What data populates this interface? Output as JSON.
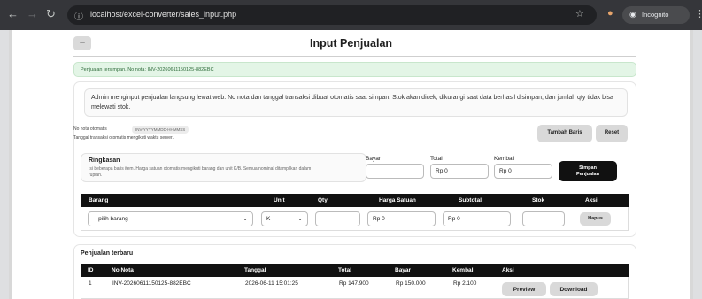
{
  "browser": {
    "url": "localhost/excel-converter/sales_input.php",
    "incognito_label": "Incognito"
  },
  "page": {
    "title": "Input Penjualan",
    "back_label": "←",
    "alert": "Penjualan tersimpan. No nota: INV-20260611150125-882EBC",
    "info": "Admin menginput penjualan langsung lewat web. No nota dan tanggal transaksi dibuat otomatis saat simpan. Stok akan dicek, dikurangi saat data berhasil disimpan, dan jumlah qty tidak bisa melewati stok.",
    "nota_label": "No nota otomatis",
    "nota_pattern": "INV-YYYYMMDD-HHMMSS",
    "date_note": "Tanggal transaksi otomatis mengikuti waktu server.",
    "add_row_label": "Tambah Baris",
    "reset_label": "Reset"
  },
  "summary": {
    "heading": "Ringkasan",
    "desc": "Isi beberapa baris item. Harga satuan otomatis mengikuti barang dan unit K/B. Semua nominal ditampilkan dalam rupiah.",
    "bayar_label": "Bayar",
    "bayar_value": "",
    "total_label": "Total",
    "total_value": "Rp 0",
    "kembali_label": "Kembali",
    "kembali_value": "Rp 0",
    "save_label_1": "Simpan",
    "save_label_2": "Penjualan"
  },
  "items_table": {
    "headers": [
      "Barang",
      "Unit",
      "Qty",
      "Harga Satuan",
      "Subtotal",
      "Stok",
      "Aksi"
    ],
    "row": {
      "barang": "-- pilih barang --",
      "unit": "K",
      "qty": "",
      "harga": "Rp 0",
      "subtotal": "Rp 0",
      "stok": "-",
      "action": "Hapus"
    }
  },
  "recent": {
    "heading": "Penjualan terbaru",
    "headers": [
      "ID",
      "No Nota",
      "Tanggal",
      "Total",
      "Bayar",
      "Kembali",
      "Aksi"
    ],
    "rows": [
      {
        "id": "1",
        "nota": "INV-20260611150125-882EBC",
        "tanggal": "2026-06-11 15:01:25",
        "total": "Rp 147.900",
        "bayar": "Rp 150.000",
        "kembali": "Rp 2.100",
        "preview": "Preview",
        "download": "Download"
      }
    ]
  }
}
